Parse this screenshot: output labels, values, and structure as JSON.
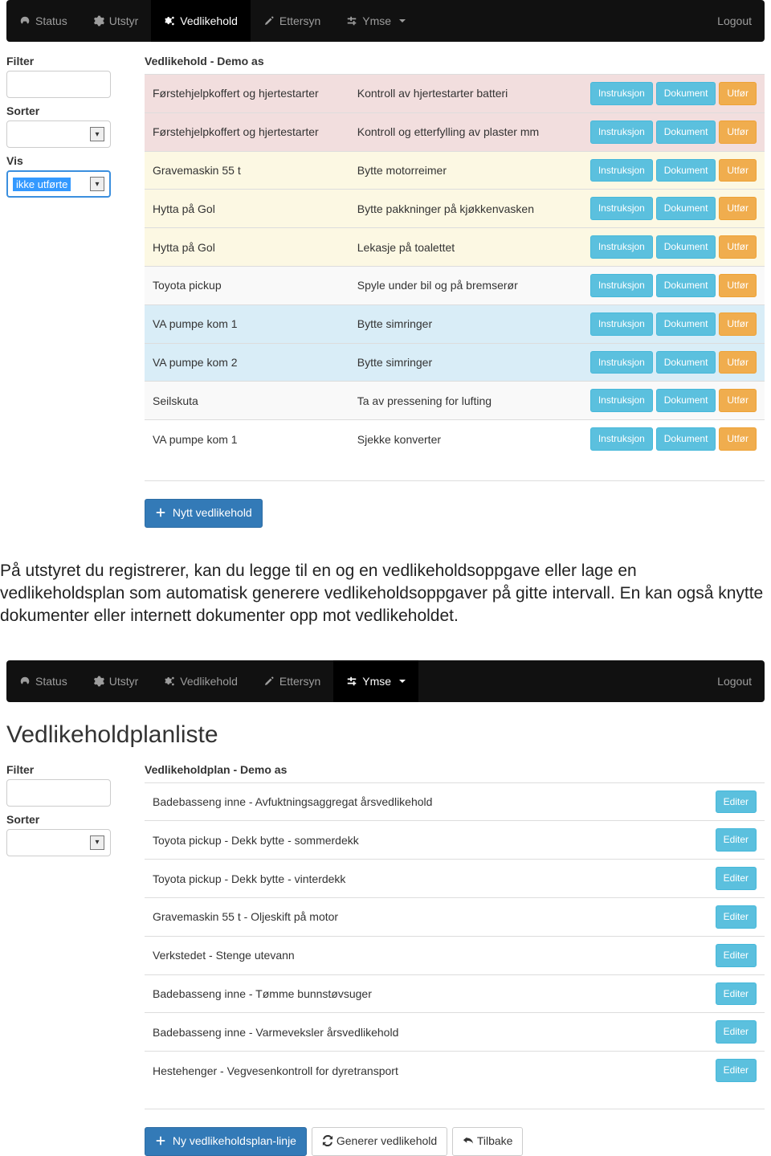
{
  "nav1": {
    "items": [
      {
        "icon": "dashboard",
        "label": "Status"
      },
      {
        "icon": "gear",
        "label": "Utstyr"
      },
      {
        "icon": "cogs",
        "label": "Vedlikehold"
      },
      {
        "icon": "pencil",
        "label": "Ettersyn"
      },
      {
        "icon": "sliders",
        "label": "Ymse"
      }
    ],
    "activeIndex": 2,
    "logout": "Logout"
  },
  "filter_label": "Filter",
  "sorter_label": "Sorter",
  "vis_label": "Vis",
  "vis_value": "ikke utførte",
  "main1": {
    "heading": "Vedlikehold - Demo as",
    "rows": [
      {
        "eq": "Førstehjelpkoffert og hjertestarter",
        "task": "Kontroll av hjertestarter batteri",
        "cls": "row-pink"
      },
      {
        "eq": "Førstehjelpkoffert og hjertestarter",
        "task": "Kontroll og etterfylling av plaster mm",
        "cls": "row-pink"
      },
      {
        "eq": "Gravemaskin 55 t",
        "task": "Bytte motorreimer",
        "cls": "row-yellow"
      },
      {
        "eq": "Hytta på Gol",
        "task": "Bytte pakkninger på kjøkkenvasken",
        "cls": "row-yellow"
      },
      {
        "eq": "Hytta på Gol",
        "task": "Lekasje på toalettet",
        "cls": "row-yellow"
      },
      {
        "eq": "Toyota pickup",
        "task": "Spyle under bil og på bremserør",
        "cls": "row-grey"
      },
      {
        "eq": "VA pumpe kom 1",
        "task": "Bytte simringer",
        "cls": "row-blue"
      },
      {
        "eq": "VA pumpe kom 2",
        "task": "Bytte simringer",
        "cls": "row-blue"
      },
      {
        "eq": "Seilskuta",
        "task": "Ta av pressening for lufting",
        "cls": "row-grey"
      },
      {
        "eq": "VA pumpe kom 1",
        "task": "Sjekke konverter",
        "cls": "row-white"
      }
    ],
    "btn_instruksjon": "Instruksjon",
    "btn_dokument": "Dokument",
    "btn_utfor": "Utfør",
    "btn_new": "Nytt vedlikehold"
  },
  "paragraph": "På utstyret du registrerer, kan du legge til en og en vedlikeholdsoppgave eller lage en vedlikeholdsplan som automatisk generere vedlikeholdsoppgaver på gitte intervall. En kan også knytte dokumenter eller internett dokumenter opp mot vedlikeholdet.",
  "nav2": {
    "items": [
      {
        "icon": "dashboard",
        "label": "Status"
      },
      {
        "icon": "gear",
        "label": "Utstyr"
      },
      {
        "icon": "cogs",
        "label": "Vedlikehold"
      },
      {
        "icon": "pencil",
        "label": "Ettersyn"
      },
      {
        "icon": "sliders",
        "label": "Ymse"
      }
    ],
    "activeIndex": 4,
    "logout": "Logout"
  },
  "page2_title": "Vedlikeholdplanliste",
  "main2": {
    "heading": "Vedlikeholdplan - Demo as",
    "rows": [
      "Badebasseng inne - Avfuktningsaggregat årsvedlikehold",
      "Toyota pickup - Dekk bytte - sommerdekk",
      "Toyota pickup - Dekk bytte - vinterdekk",
      "Gravemaskin 55 t - Oljeskift på motor",
      "Verkstedet - Stenge utevann",
      "Badebasseng inne - Tømme bunnstøvsuger",
      "Badebasseng inne - Varmeveksler årsvedlikehold",
      "Hestehenger - Vegvesenkontroll for dyretransport"
    ],
    "btn_editer": "Editer",
    "btn_new_line": "Ny vedlikeholdsplan-linje",
    "btn_gen": "Generer vedlikehold",
    "btn_back": "Tilbake"
  }
}
